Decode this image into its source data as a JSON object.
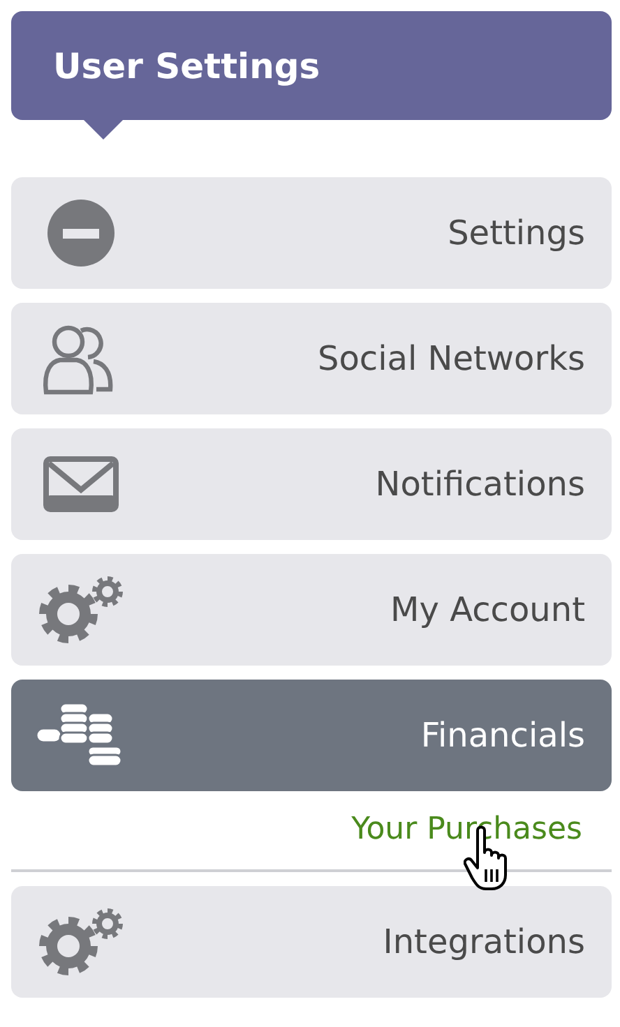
{
  "header": {
    "title": "User Settings"
  },
  "menu": [
    {
      "label": "Settings",
      "selected": false
    },
    {
      "label": "Social Networks",
      "selected": false
    },
    {
      "label": "Notifications",
      "selected": false
    },
    {
      "label": "My Account",
      "selected": false
    },
    {
      "label": "Financials",
      "selected": true,
      "children": [
        {
          "label": "Your Purchases",
          "hovered": true
        }
      ]
    },
    {
      "label": "Integrations",
      "selected": false
    }
  ]
}
